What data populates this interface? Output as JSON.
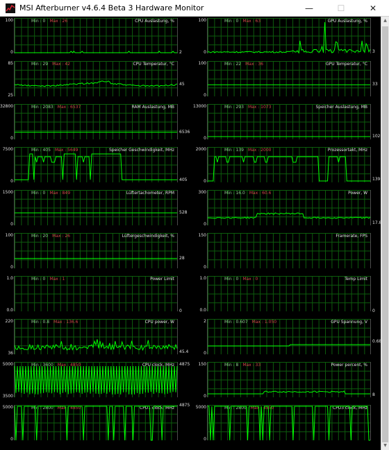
{
  "window": {
    "title": "MSI Afterburner v4.6.4 Beta 3 Hardware Monitor",
    "minimize_icon": "minimize-icon",
    "maximize_icon": "maximize-icon",
    "close_icon": "close-icon"
  },
  "accent_colors": {
    "line": "#00ff00",
    "grid": "#0d5d0d",
    "min_text": "#8fd08f",
    "max_text": "#d24a4a",
    "background": "#000000"
  },
  "graphs": [
    {
      "title": "CPU Auslastung, %",
      "scale_max": "100",
      "scale_min": "0",
      "min": "Min : 0",
      "max": "Max : 26",
      "current": "2",
      "current_value": 2,
      "y_max": 100,
      "y_min": 0,
      "shape": "low-flat"
    },
    {
      "title": "GPU Auslastung, %",
      "scale_max": "100",
      "scale_min": "0",
      "min": "Min : 0",
      "max": "Max : 63",
      "current": "3",
      "current_value": 3,
      "y_max": 100,
      "y_min": 0,
      "shape": "gpu-spiky"
    },
    {
      "title": "CPU Temperatur, °C",
      "scale_max": "85",
      "scale_min": "25",
      "min": "Min : 29",
      "max": "Max : 42",
      "current": "45",
      "current_value": 45,
      "y_max": 85,
      "y_min": 25,
      "shape": "wavy"
    },
    {
      "title": "GPU Temperatur, °C",
      "scale_max": "100",
      "scale_min": "0",
      "min": "Min : 22",
      "max": "Max : 36",
      "current": "33",
      "current_value": 33,
      "y_max": 100,
      "y_min": 0,
      "shape": "flat"
    },
    {
      "title": "RAM Auslastung, MB",
      "scale_max": "32800",
      "scale_min": "0",
      "min": "Min : 2083",
      "max": "Max : 6537",
      "current": "6536",
      "current_value": 6536,
      "y_max": 32800,
      "y_min": 0,
      "shape": "flat"
    },
    {
      "title": "Speicher Auslastung, MB",
      "scale_max": "13000",
      "scale_min": "0",
      "min": "Min : 293",
      "max": "Max : 1073",
      "current": "1028",
      "current_value": 1028,
      "y_max": 13000,
      "y_min": 0,
      "shape": "flat"
    },
    {
      "title": "Speicher Geschwindigkeit, MHz",
      "scale_max": "7500",
      "scale_min": "0",
      "min": "Min : 405",
      "max": "Max : 5649",
      "current": "405",
      "current_value": 405,
      "y_max": 7500,
      "y_min": 0,
      "shape": "square-a"
    },
    {
      "title": "Prozessortakt, MHz",
      "scale_max": "2000",
      "scale_min": "0",
      "min": "Min : 139",
      "max": "Max : 2000",
      "current": "139",
      "current_value": 139,
      "y_max": 2000,
      "y_min": 0,
      "shape": "square-b"
    },
    {
      "title": "Lüftertachometer, RPM",
      "scale_max": "1500",
      "scale_min": "0",
      "min": "Min : 0",
      "max": "Max : 849",
      "current": "528",
      "current_value": 528,
      "y_max": 1500,
      "y_min": 0,
      "shape": "flat"
    },
    {
      "title": "Power, W",
      "scale_max": "300",
      "scale_min": "0",
      "min": "Min : 16.0",
      "max": "Max : 60.6",
      "current": "17.8",
      "current_value": 17.8,
      "y_max": 300,
      "y_min": 0,
      "shape": "power"
    },
    {
      "title": "Lüftergeschwindigkeit, %",
      "scale_max": "100",
      "scale_min": "0",
      "min": "Min : 20",
      "max": "Max : 26",
      "current": "28",
      "current_value": 28,
      "y_max": 100,
      "y_min": 0,
      "shape": "flat"
    },
    {
      "title": "Framerate, FPS",
      "scale_max": "150",
      "scale_min": "0",
      "min": "",
      "max": "",
      "current": "",
      "current_value": null,
      "y_max": 150,
      "y_min": 0,
      "shape": "none"
    },
    {
      "title": "Power Limit",
      "scale_max": "1.0",
      "scale_min": "0.0",
      "min": "Min : 0",
      "max": "Max : 1",
      "current": "0",
      "current_value": 0,
      "y_max": 1,
      "y_min": 0,
      "shape": "none"
    },
    {
      "title": "Temp Limit",
      "scale_max": "1.0",
      "scale_min": "0.0",
      "min": "Min : 0",
      "max": "Max : 0",
      "current": "0",
      "current_value": 0,
      "y_max": 1,
      "y_min": 0,
      "shape": "none"
    },
    {
      "title": "CPU power, W",
      "scale_max": "220",
      "scale_min": "36",
      "min": "Min : 0.8",
      "max": "Max : 136.6",
      "current": "45.4",
      "current_value": 45.4,
      "y_max": 220,
      "y_min": 36,
      "shape": "noisy"
    },
    {
      "title": "GPU Spannung, V",
      "scale_max": "2",
      "scale_min": "0",
      "min": "Min : 0.607",
      "max": "Max : 1.050",
      "current": "0.687",
      "current_value": 0.687,
      "y_max": 2,
      "y_min": 0,
      "shape": "step-low"
    },
    {
      "title": "CPU clock, MHz",
      "scale_max": "5000",
      "scale_min": "3500",
      "min": "Min : 3600",
      "max": "Max : 4850",
      "current": "4875",
      "current_value": 4875,
      "y_max": 5000,
      "y_min": 3500,
      "shape": "dense"
    },
    {
      "title": "Power percent, %",
      "scale_max": "150",
      "scale_min": "0",
      "min": "Min : 8",
      "max": "Max : 33",
      "current": "8",
      "current_value": 8,
      "y_max": 150,
      "y_min": 0,
      "shape": "power-low"
    },
    {
      "title": "CPU1 clock, MHz",
      "scale_max": "5000",
      "scale_min": "0",
      "min": "Min : 2800",
      "max": "Max : 4850",
      "current": "4875",
      "current_value": 4875,
      "y_max": 5000,
      "y_min": 0,
      "shape": "spikes-down"
    },
    {
      "title": "CPU3 clock, MHz",
      "scale_max": "5000",
      "scale_min": "0",
      "min": "Min : 2800",
      "max": "Max : 4850",
      "current": "",
      "current_value": null,
      "y_max": 5000,
      "y_min": 0,
      "shape": "spikes-down"
    }
  ]
}
